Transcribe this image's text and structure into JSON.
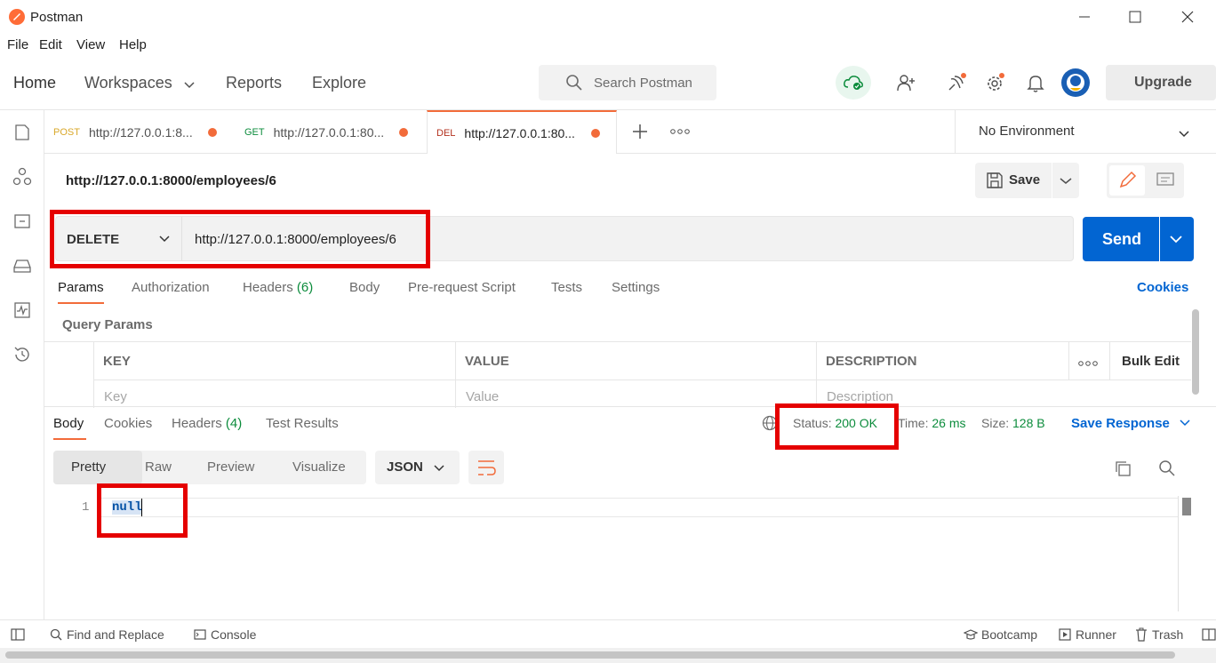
{
  "window": {
    "title": "Postman",
    "brand_color": "#ff6c37"
  },
  "menu": [
    "File",
    "Edit",
    "View",
    "Help"
  ],
  "header": {
    "home": "Home",
    "workspaces": "Workspaces",
    "reports": "Reports",
    "explore": "Explore",
    "search_placeholder": "Search Postman",
    "upgrade": "Upgrade"
  },
  "tabs": [
    {
      "method": "POST",
      "url": "http://127.0.0.1:8...",
      "method_color": "#d9a82b"
    },
    {
      "method": "GET",
      "url": "http://127.0.0.1:80...",
      "method_color": "#0c8c3c"
    },
    {
      "method": "DEL",
      "url": "http://127.0.0.1:80...",
      "method_color": "#b3321f"
    }
  ],
  "environment": "No Environment",
  "request": {
    "name": "http://127.0.0.1:8000/employees/6",
    "save": "Save",
    "method": "DELETE",
    "url": "http://127.0.0.1:8000/employees/6",
    "send": "Send"
  },
  "request_tabs": {
    "params": "Params",
    "authorization": "Authorization",
    "headers": "Headers",
    "headers_count": "(6)",
    "body": "Body",
    "prerequest": "Pre-request Script",
    "tests": "Tests",
    "settings": "Settings",
    "cookies": "Cookies"
  },
  "query_params": {
    "title": "Query Params",
    "col_key": "KEY",
    "col_value": "VALUE",
    "col_description": "DESCRIPTION",
    "bulk_edit": "Bulk Edit",
    "key_placeholder": "Key",
    "value_placeholder": "Value",
    "description_placeholder": "Description"
  },
  "response": {
    "body": "Body",
    "cookies": "Cookies",
    "headers": "Headers",
    "headers_count": "(4)",
    "test_results": "Test Results",
    "status_label": "Status:",
    "status_value": "200 OK",
    "time_label": "Time:",
    "time_value": "26 ms",
    "size_label": "Size:",
    "size_value": "128 B",
    "save_response": "Save Response",
    "view_tabs": [
      "Pretty",
      "Raw",
      "Preview",
      "Visualize"
    ],
    "format": "JSON",
    "line_number": "1",
    "content": "null"
  },
  "statusbar": {
    "find_replace": "Find and Replace",
    "console": "Console",
    "bootcamp": "Bootcamp",
    "runner": "Runner",
    "trash": "Trash"
  },
  "colors": {
    "accent_blue": "#0265d2",
    "status_green": "#0c8c3c",
    "highlight_red": "#e50000",
    "orange": "#f26b3a"
  }
}
